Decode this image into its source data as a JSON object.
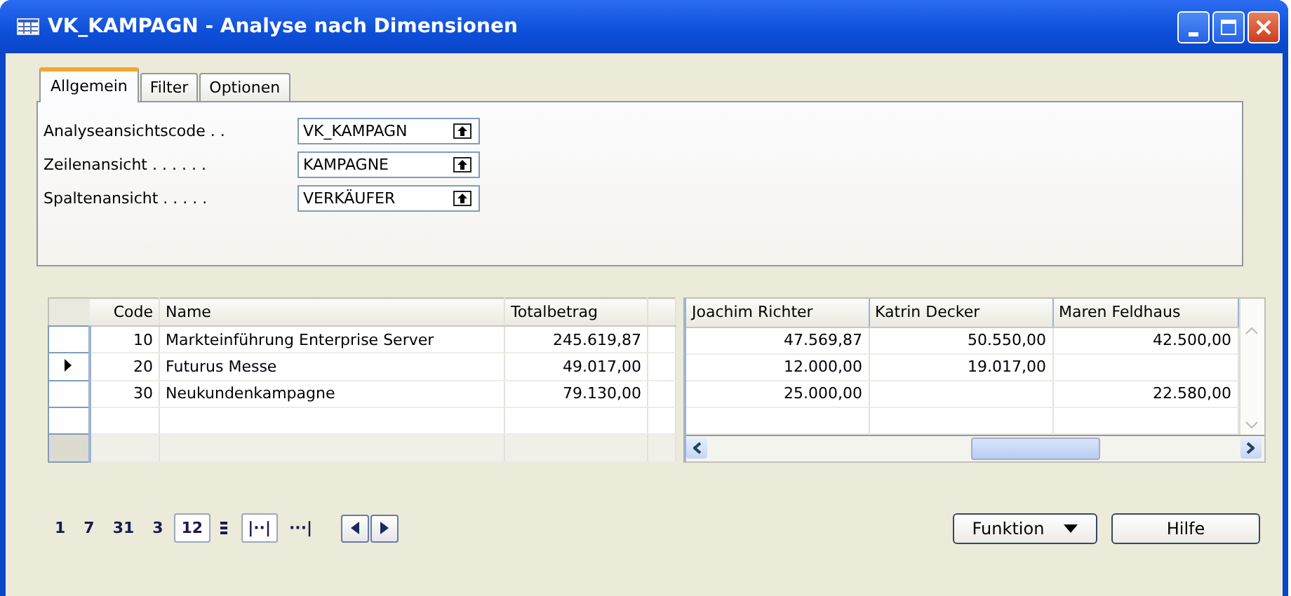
{
  "window": {
    "title": "VK_KAMPAGN - Analyse nach Dimensionen"
  },
  "tabs": [
    {
      "label": "Allgemein",
      "selected": true
    },
    {
      "label": "Filter",
      "selected": false
    },
    {
      "label": "Optionen",
      "selected": false
    }
  ],
  "fields": [
    {
      "label": "Analyseansichtscode . .",
      "value": "VK_KAMPAGN"
    },
    {
      "label": "Zeilenansicht . . . . . .",
      "value": "KAMPAGNE"
    },
    {
      "label": "Spaltenansicht . . . . .",
      "value": "VERKÄUFER"
    }
  ],
  "table": {
    "columns": [
      "Code",
      "Name",
      "Totalbetrag"
    ],
    "rows": [
      {
        "code": "10",
        "name": "Markteinführung Enterprise Server",
        "total": "245.619,87",
        "selected": false
      },
      {
        "code": "20",
        "name": "Futurus Messe",
        "total": "49.017,00",
        "selected": true
      },
      {
        "code": "30",
        "name": "Neukundenkampagne",
        "total": "79.130,00",
        "selected": false
      }
    ]
  },
  "matrix": {
    "columns": [
      "Joachim Richter",
      "Katrin Decker",
      "Maren Feldhaus"
    ],
    "rows": [
      [
        "47.569,87",
        "50.550,00",
        "42.500,00"
      ],
      [
        "12.000,00",
        "19.017,00",
        ""
      ],
      [
        "25.000,00",
        "",
        "22.580,00"
      ]
    ]
  },
  "periods": [
    {
      "label": "1",
      "selected": false
    },
    {
      "label": "7",
      "selected": false
    },
    {
      "label": "31",
      "selected": false
    },
    {
      "label": "3",
      "selected": false
    },
    {
      "label": "12",
      "selected": true
    }
  ],
  "amount_types": [
    {
      "label": "|··|",
      "selected": true
    },
    {
      "label": "···|",
      "selected": false
    }
  ],
  "buttons": [
    {
      "label": "Funktion",
      "kind": "menu"
    },
    {
      "label": "Hilfe",
      "kind": "plain"
    }
  ]
}
